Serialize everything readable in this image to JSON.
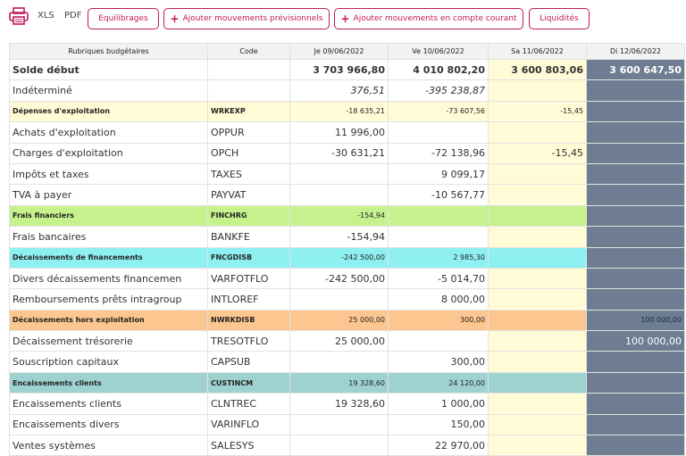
{
  "toolbar": {
    "xls": "XLS",
    "pdf": "PDF",
    "equilibrages": "Equilibrages",
    "ajouter_previsionnels": "Ajouter mouvements prévisionnels",
    "ajouter_compte_courant": "Ajouter mouvements en compte courant",
    "liquidites": "Liquidités",
    "accent_color": "#c2185b"
  },
  "table": {
    "headers": [
      "Rubriques budgétaires",
      "Code",
      "Je 09/06/2022",
      "Ve 10/06/2022",
      "Sa 11/06/2022",
      "Di 12/06/2022"
    ],
    "rows": [
      [
        "Solde début",
        "",
        "3 703 966,80",
        "4 010 802,20",
        "3 600 803,06",
        "3 600 647,50"
      ],
      [
        "Indéterminé",
        "",
        "376,51",
        "-395 238,87",
        "",
        ""
      ],
      [
        "Dépenses d'exploitation",
        "WRKEXP",
        "-18 635,21",
        "-73 607,56",
        "-15,45",
        ""
      ],
      [
        "Achats d'exploitation",
        "OPPUR",
        "11 996,00",
        "",
        "",
        ""
      ],
      [
        "Charges d'exploitation",
        "OPCH",
        "-30 631,21",
        "-72 138,96",
        "-15,45",
        ""
      ],
      [
        "Impôts et taxes",
        "TAXES",
        "",
        "9 099,17",
        "",
        ""
      ],
      [
        "TVA à payer",
        "PAYVAT",
        "",
        "-10 567,77",
        "",
        ""
      ],
      [
        "Frais financiers",
        "FINCHRG",
        "-154,94",
        "",
        "",
        ""
      ],
      [
        "Frais bancaires",
        "BANKFE",
        "-154,94",
        "",
        "",
        ""
      ],
      [
        "Décaissements de financements",
        "FNCGDISB",
        "-242 500,00",
        "2 985,30",
        "",
        ""
      ],
      [
        "Divers décaissements financemen",
        "VARFOTFLO",
        "-242 500,00",
        "-5 014,70",
        "",
        ""
      ],
      [
        "Remboursements prêts intragroup",
        "INTLOREF",
        "",
        "8 000,00",
        "",
        ""
      ],
      [
        "Décaissements hors exploitation",
        "NWRKDISB",
        "25 000,00",
        "300,00",
        "",
        "100 000,00"
      ],
      [
        "Décaissement trésorerie",
        "TRESOTFLO",
        "25 000,00",
        "",
        "",
        "100 000,00"
      ],
      [
        "Souscription capitaux",
        "CAPSUB",
        "",
        "300,00",
        "",
        ""
      ],
      [
        "Encaissements clients",
        "CUSTINCM",
        "19 328,60",
        "24 120,00",
        "",
        ""
      ],
      [
        "Encaissements clients",
        "CLNTREC",
        "19 328,60",
        "1 000,00",
        "",
        ""
      ],
      [
        "Encaissements divers",
        "VARINFLO",
        "",
        "150,00",
        "",
        ""
      ],
      [
        "Ventes systèmes",
        "SALESYS",
        "",
        "22 970,00",
        "",
        ""
      ]
    ],
    "row_kinds": [
      "bold",
      "italic",
      "yellow",
      "",
      "",
      "",
      "",
      "green",
      "",
      "cyan",
      "",
      "",
      "orange",
      "",
      "",
      "teal",
      "",
      "",
      ""
    ],
    "sat_color": "#fffbd6",
    "sun_color": "#6e7d91"
  }
}
